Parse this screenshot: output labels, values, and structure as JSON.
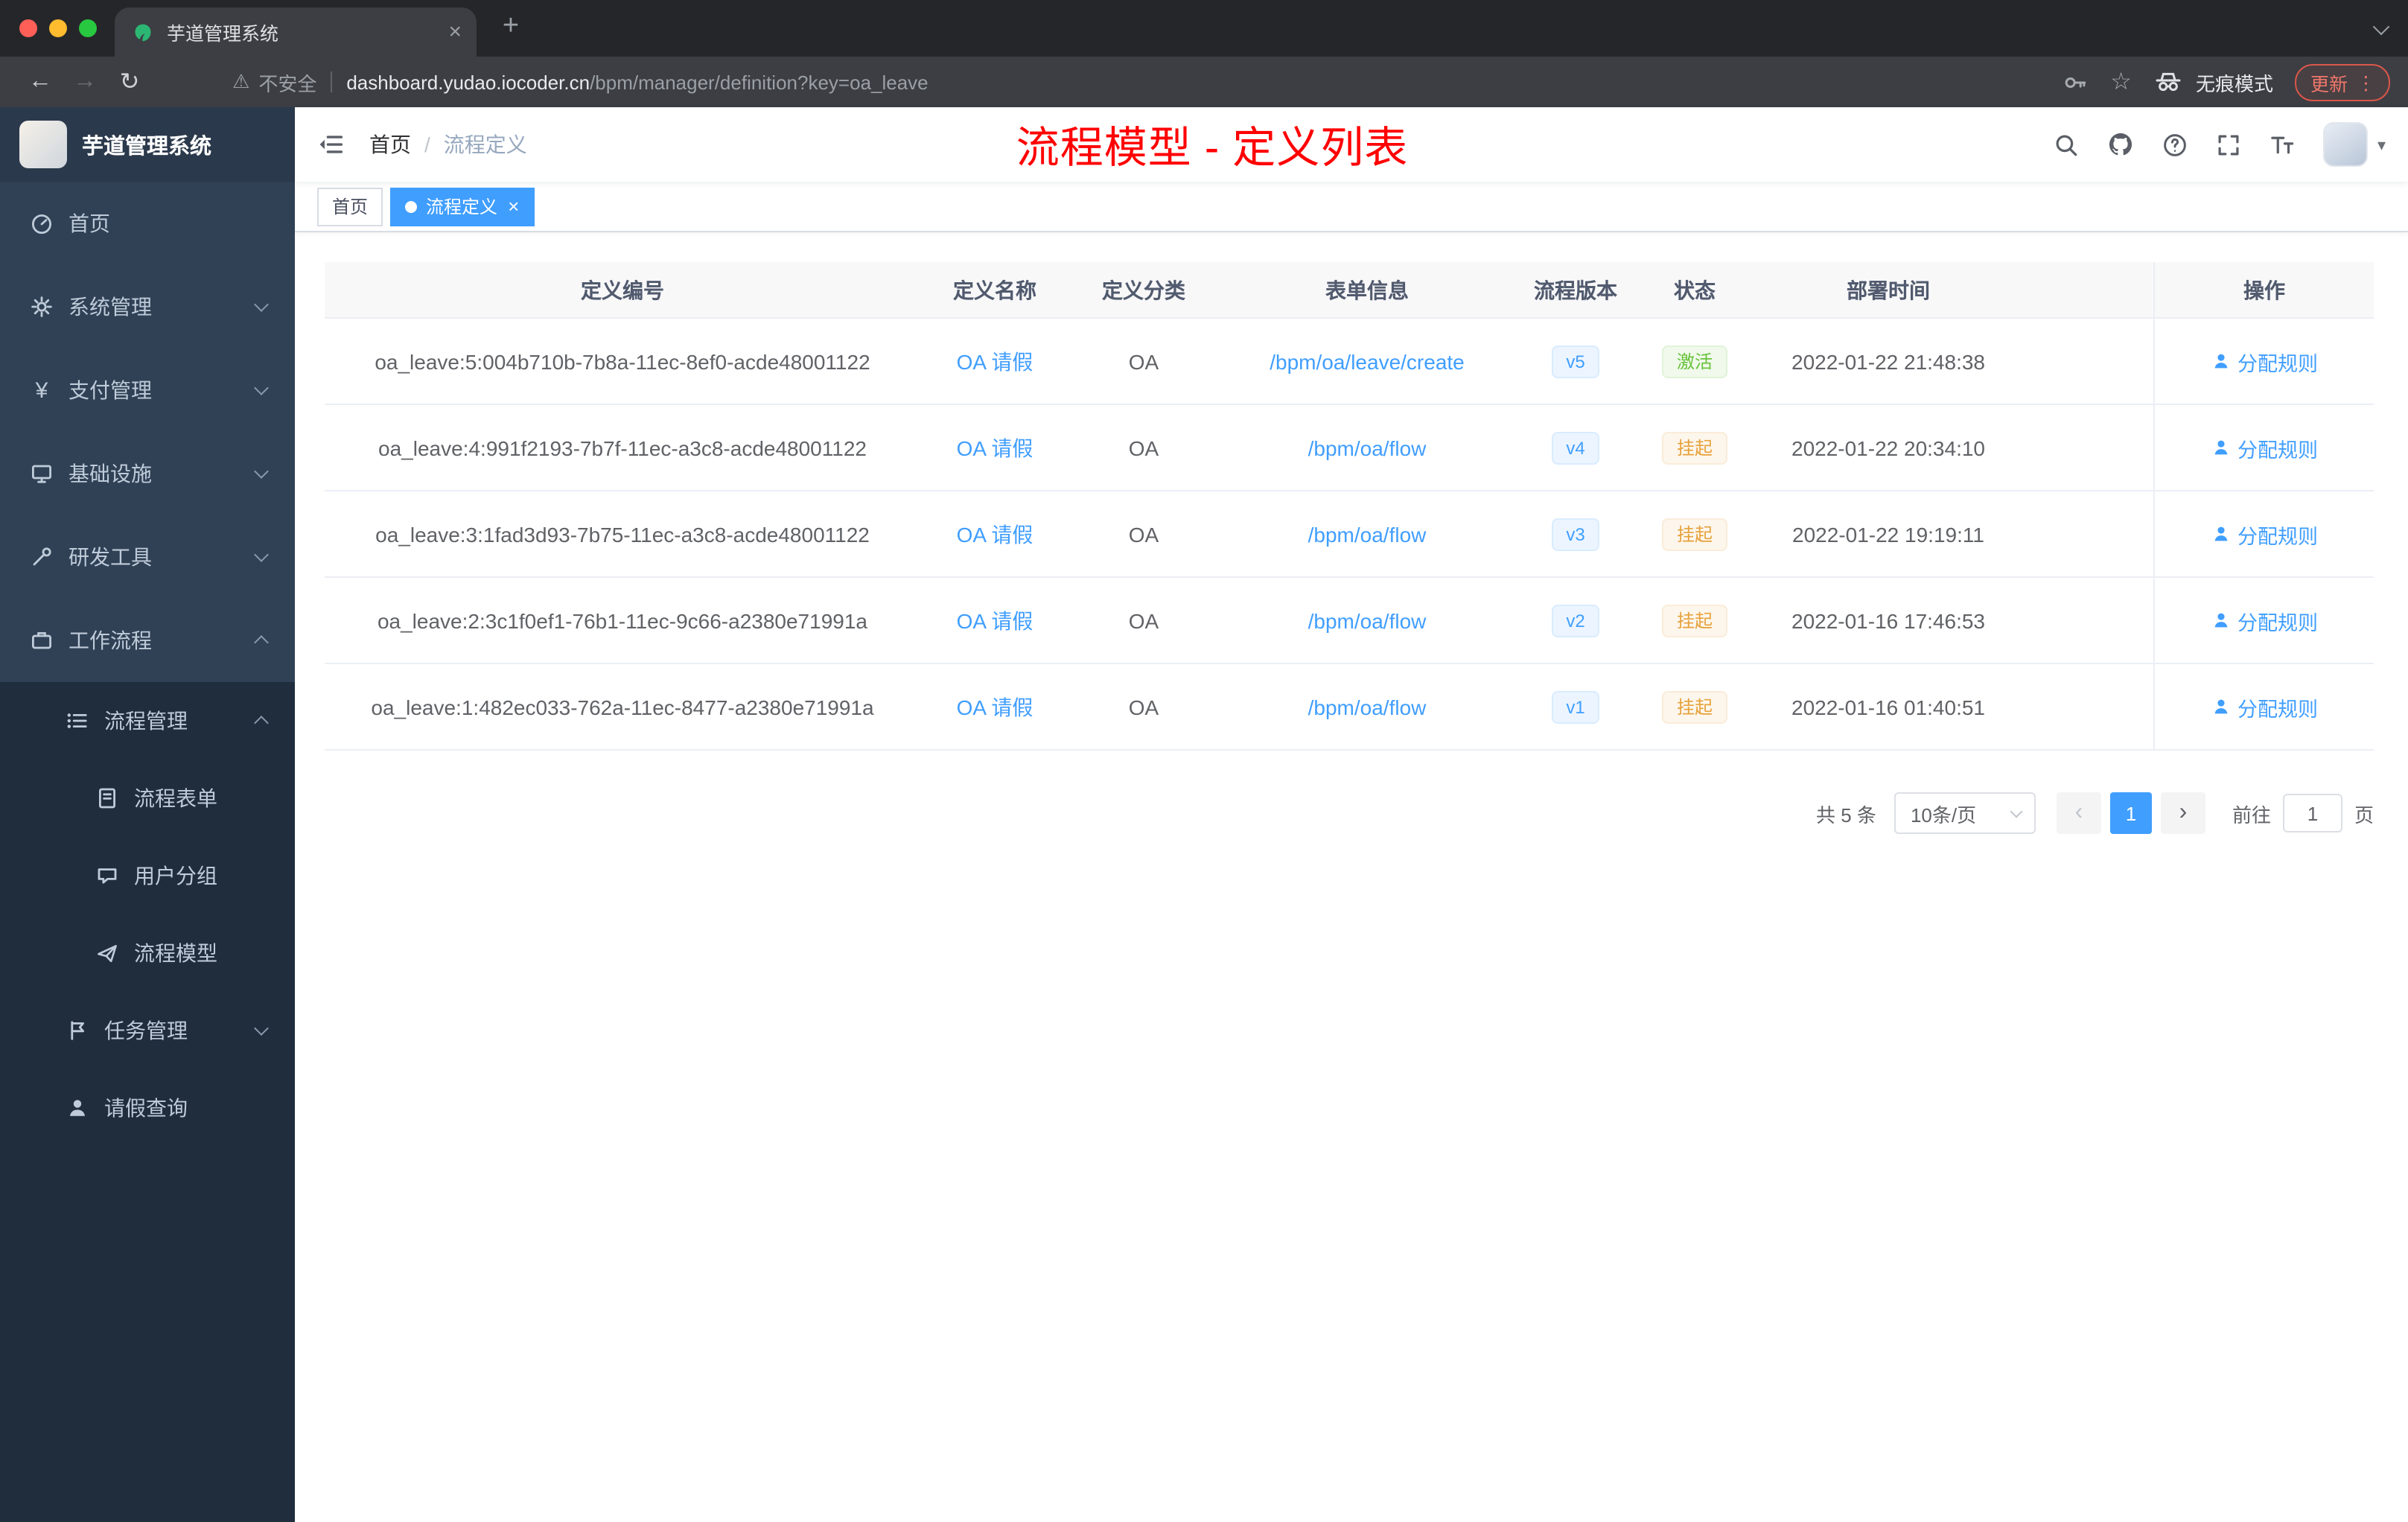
{
  "browser": {
    "tab_title": "芋道管理系统",
    "address": {
      "security_label": "不安全",
      "domain": "dashboard.yudao.iocoder.cn",
      "path": "/bpm/manager/definition?key=oa_leave"
    },
    "incognito_label": "无痕模式",
    "update_label": "更新"
  },
  "icons": {
    "back": "←",
    "forward": "→",
    "reload": "↻",
    "warning": "⚠",
    "star": "☆",
    "close": "×",
    "new_tab": "+",
    "menu_dots": "⋮",
    "caret_down": "▾",
    "yen": "¥"
  },
  "sidebar": {
    "logo_title": "芋道管理系统",
    "menu": [
      {
        "label": "首页"
      },
      {
        "label": "系统管理"
      },
      {
        "label": "支付管理"
      },
      {
        "label": "基础设施"
      },
      {
        "label": "研发工具"
      },
      {
        "label": "工作流程"
      }
    ],
    "submenu": [
      {
        "label": "流程管理"
      },
      {
        "label": "流程表单"
      },
      {
        "label": "用户分组"
      },
      {
        "label": "流程模型"
      },
      {
        "label": "任务管理"
      },
      {
        "label": "请假查询"
      }
    ]
  },
  "navbar": {
    "breadcrumb": {
      "home": "首页",
      "sep": "/",
      "current": "流程定义"
    },
    "annotation": "流程模型 - 定义列表"
  },
  "tags": [
    {
      "label": "首页"
    },
    {
      "label": "流程定义"
    }
  ],
  "table": {
    "columns": [
      "定义编号",
      "定义名称",
      "定义分类",
      "表单信息",
      "流程版本",
      "状态",
      "部署时间",
      "操作"
    ],
    "rows": [
      {
        "id": "oa_leave:5:004b710b-7b8a-11ec-8ef0-acde48001122",
        "name": "OA 请假",
        "category": "OA",
        "form": "/bpm/oa/leave/create",
        "version": "v5",
        "status": "激活",
        "status_type": "success",
        "time": "2022-01-22 21:48:38",
        "action": "分配规则"
      },
      {
        "id": "oa_leave:4:991f2193-7b7f-11ec-a3c8-acde48001122",
        "name": "OA 请假",
        "category": "OA",
        "form": "/bpm/oa/flow",
        "version": "v4",
        "status": "挂起",
        "status_type": "warning",
        "time": "2022-01-22 20:34:10",
        "action": "分配规则"
      },
      {
        "id": "oa_leave:3:1fad3d93-7b75-11ec-a3c8-acde48001122",
        "name": "OA 请假",
        "category": "OA",
        "form": "/bpm/oa/flow",
        "version": "v3",
        "status": "挂起",
        "status_type": "warning",
        "time": "2022-01-22 19:19:11",
        "action": "分配规则"
      },
      {
        "id": "oa_leave:2:3c1f0ef1-76b1-11ec-9c66-a2380e71991a",
        "name": "OA 请假",
        "category": "OA",
        "form": "/bpm/oa/flow",
        "version": "v2",
        "status": "挂起",
        "status_type": "warning",
        "time": "2022-01-16 17:46:53",
        "action": "分配规则"
      },
      {
        "id": "oa_leave:1:482ec033-762a-11ec-8477-a2380e71991a",
        "name": "OA 请假",
        "category": "OA",
        "form": "/bpm/oa/flow",
        "version": "v1",
        "status": "挂起",
        "status_type": "warning",
        "time": "2022-01-16 01:40:51",
        "action": "分配规则"
      }
    ]
  },
  "pagination": {
    "total": "共 5 条",
    "page_size": "10条/页",
    "prev": "‹",
    "current_page": "1",
    "next": "›",
    "goto_label": "前往",
    "goto_value": "1",
    "page_unit": "页"
  }
}
